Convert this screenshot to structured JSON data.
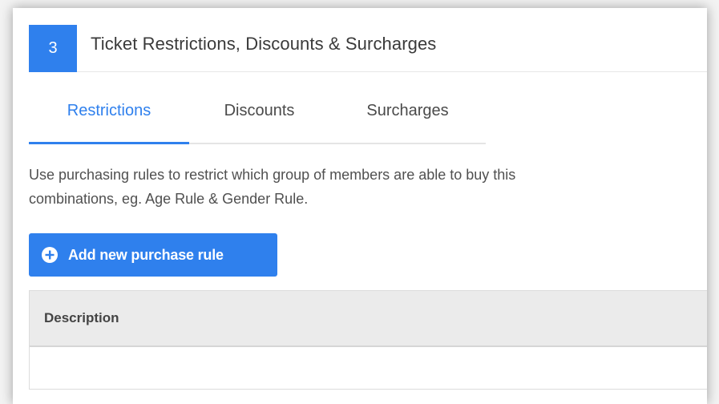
{
  "section": {
    "step_number": "3",
    "title": "Ticket Restrictions, Discounts & Surcharges"
  },
  "tabs": [
    {
      "label": "Restrictions",
      "active": true
    },
    {
      "label": "Discounts",
      "active": false
    },
    {
      "label": "Surcharges",
      "active": false
    }
  ],
  "description": {
    "line1": "Use purchasing rules to restrict which group of members are able to buy this",
    "line2": "combinations, eg. Age Rule & Gender Rule."
  },
  "add_button": {
    "label": "Add new purchase rule",
    "icon": "plus-circle-icon"
  },
  "table": {
    "columns": [
      "Description"
    ],
    "rows": []
  },
  "colors": {
    "accent": "#2f80ed",
    "header_bg": "#ebebeb"
  }
}
